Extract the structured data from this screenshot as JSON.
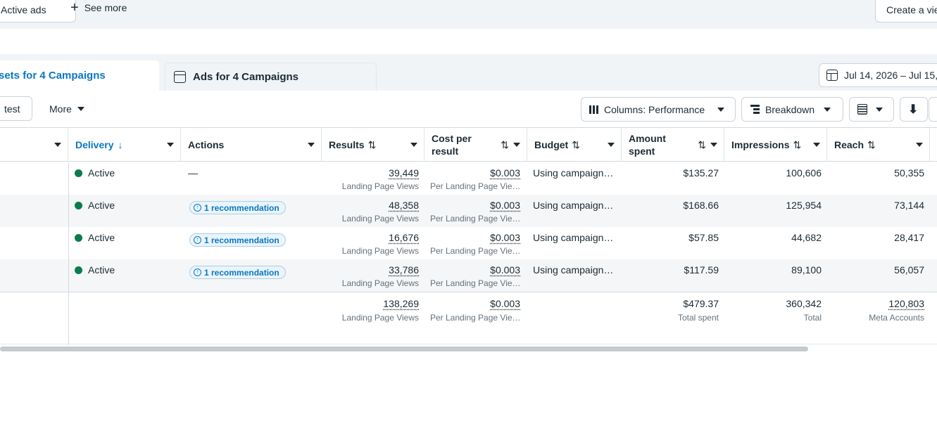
{
  "filter_bar": {
    "active_chip": "Active ads",
    "see_more": "See more",
    "create_view": "Create a vie"
  },
  "tabs": {
    "adsets": "sets for 4 Campaigns",
    "ads": "Ads for 4 Campaigns"
  },
  "date_range": "Jul 14, 2026 – Jul 15,",
  "toolbar": {
    "test": "test",
    "more": "More",
    "columns": "Columns: Performance",
    "breakdown": "Breakdown"
  },
  "columns": {
    "delivery": "Delivery",
    "actions": "Actions",
    "results": "Results",
    "cost_per_result_l1": "Cost per",
    "cost_per_result_l2": "result",
    "budget": "Budget",
    "amount_spent_l1": "Amount",
    "amount_spent_l2": "spent",
    "impressions": "Impressions",
    "reach": "Reach"
  },
  "rows": [
    {
      "delivery": "Active",
      "action": "—",
      "results": "39,449",
      "results_sub": "Landing Page Views",
      "cost": "$0.003",
      "cost_sub": "Per Landing Page Vie…",
      "budget": "Using campaign…",
      "amount": "$135.27",
      "impressions": "100,606",
      "reach": "50,355"
    },
    {
      "delivery": "Active",
      "action": "1 recommendation",
      "results": "48,358",
      "results_sub": "Landing Page Views",
      "cost": "$0.003",
      "cost_sub": "Per Landing Page Vie…",
      "budget": "Using campaign…",
      "amount": "$168.66",
      "impressions": "125,954",
      "reach": "73,144"
    },
    {
      "delivery": "Active",
      "action": "1 recommendation",
      "results": "16,676",
      "results_sub": "Landing Page Views",
      "cost": "$0.003",
      "cost_sub": "Per Landing Page Vie…",
      "budget": "Using campaign…",
      "amount": "$57.85",
      "impressions": "44,682",
      "reach": "28,417"
    },
    {
      "delivery": "Active",
      "action": "1 recommendation",
      "results": "33,786",
      "results_sub": "Landing Page Views",
      "cost": "$0.003",
      "cost_sub": "Per Landing Page Vie…",
      "budget": "Using campaign…",
      "amount": "$117.59",
      "impressions": "89,100",
      "reach": "56,057"
    }
  ],
  "totals": {
    "results": "138,269",
    "results_sub": "Landing Page Views",
    "cost": "$0.003",
    "cost_sub": "Per Landing Page Vie…",
    "amount": "$479.37",
    "amount_sub": "Total spent",
    "impressions": "360,342",
    "impressions_sub": "Total",
    "reach": "120,803",
    "reach_sub": "Meta Accounts"
  },
  "colors": {
    "accent": "#0a78be",
    "active_dot": "#097b4d"
  }
}
